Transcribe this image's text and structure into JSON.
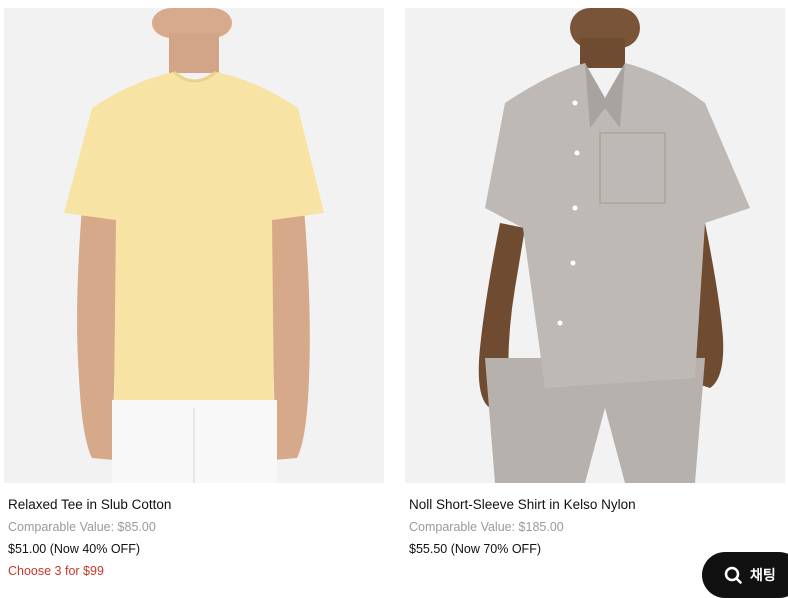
{
  "products": [
    {
      "name": "Relaxed Tee in Slub Cotton",
      "comparable": "Comparable Value: $85.00",
      "price": "$51.00 (Now 40% OFF)",
      "promo": "Choose 3 for $99"
    },
    {
      "name": "Noll Short-Sleeve Shirt in Kelso Nylon",
      "comparable": "Comparable Value: $185.00",
      "price": "$55.50 (Now 70% OFF)"
    }
  ],
  "chat": {
    "label": "채팅",
    "icon": "chat-search-icon"
  },
  "colors": {
    "promo": "#c8372d",
    "muted": "#9a9a9a",
    "tee": "#f7e4a4",
    "shirt": "#bfb9b5",
    "chat_bg": "#111111"
  }
}
